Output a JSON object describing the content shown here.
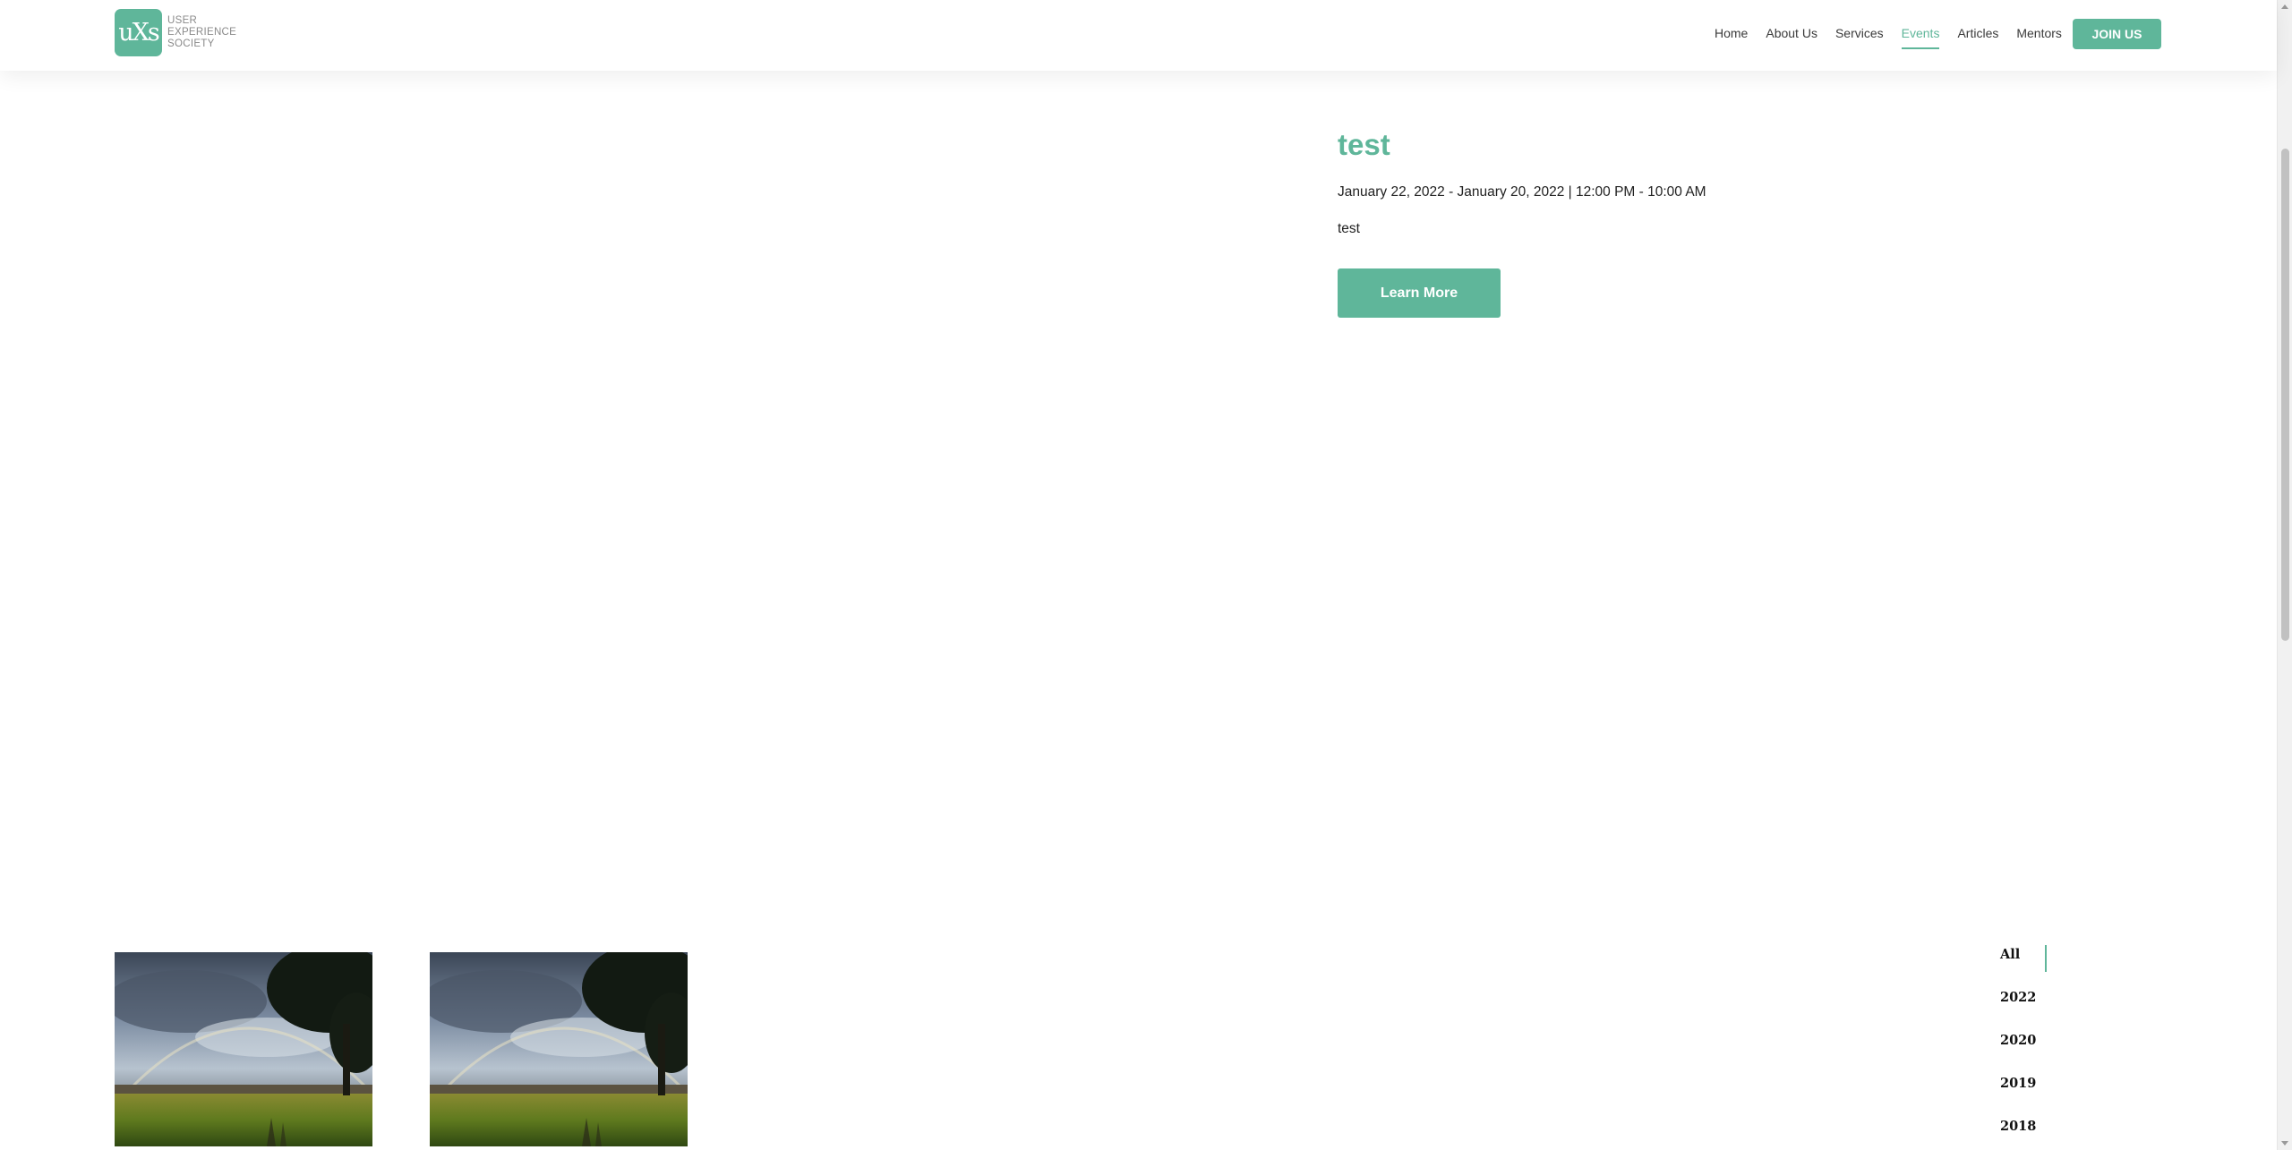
{
  "brand": {
    "mark": "uXs",
    "name_lines": [
      "USER",
      "EXPERIENCE",
      "SOCIETY"
    ]
  },
  "nav": {
    "items": [
      {
        "label": "Home"
      },
      {
        "label": "About Us"
      },
      {
        "label": "Services"
      },
      {
        "label": "Events",
        "active": true
      },
      {
        "label": "Articles"
      },
      {
        "label": "Mentors"
      }
    ],
    "cta_label": "JOIN US"
  },
  "event": {
    "title": "test",
    "dates": "January 22, 2022 - January 20, 2022 | 12:00 PM - 10:00 AM",
    "description": "test",
    "button_label": "Learn More"
  },
  "gallery": {
    "thumbnails": [
      {
        "icon": "landscape-rainbow-photo"
      },
      {
        "icon": "landscape-rainbow-photo"
      }
    ]
  },
  "year_filter": {
    "items": [
      "All",
      "2022",
      "2020",
      "2019",
      "2018"
    ],
    "selected": "All"
  },
  "colors": {
    "accent": "#5fb69a",
    "text": "#222222",
    "background": "#ffffff"
  }
}
